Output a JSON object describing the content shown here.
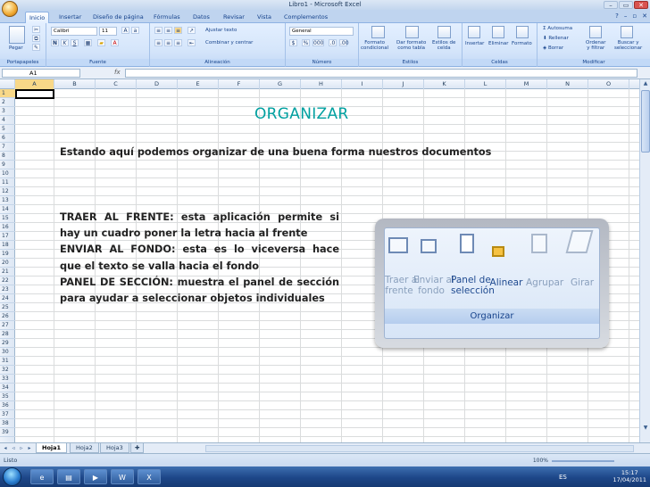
{
  "window": {
    "title": "Libro1 - Microsoft Excel",
    "min": "–",
    "max": "▭",
    "close": "✕"
  },
  "tabs": [
    "Inicio",
    "Insertar",
    "Diseño de página",
    "Fórmulas",
    "Datos",
    "Revisar",
    "Vista",
    "Complementos"
  ],
  "ribbon": {
    "paste": "Pegar",
    "font_name": "Calibri",
    "font_size": "11",
    "wrap_text": "Ajustar texto",
    "merge": "Combinar y centrar",
    "number_format": "General",
    "percent": "%",
    "thousands": "000",
    "cond_format": "Formato\ncondicional",
    "table_format": "Dar formato\ncomo tabla",
    "cell_styles": "Estilos de\ncelda",
    "insert": "Insertar",
    "delete": "Eliminar",
    "format": "Formato",
    "autosum": "Autosuma",
    "fill": "Rellenar",
    "clear": "Borrar",
    "sort_filter": "Ordenar\ny filtrar",
    "find_select": "Buscar y\nseleccionar",
    "groups": {
      "clipboard": "Portapapeles",
      "font": "Fuente",
      "alignment": "Alineación",
      "number": "Número",
      "styles": "Estilos",
      "cells": "Celdas",
      "editing": "Modificar"
    }
  },
  "formula_bar": {
    "name_box": "A1",
    "fx": "fx",
    "value": ""
  },
  "columns": [
    "A",
    "B",
    "C",
    "D",
    "E",
    "F",
    "G",
    "H",
    "I",
    "J",
    "K",
    "L",
    "M",
    "N",
    "O"
  ],
  "rows": [
    "1",
    "2",
    "3",
    "4",
    "5",
    "6",
    "7",
    "8",
    "9",
    "10",
    "11",
    "12",
    "13",
    "14",
    "15",
    "16",
    "17",
    "18",
    "19",
    "20",
    "21",
    "22",
    "23",
    "24",
    "25",
    "26",
    "27",
    "28",
    "29",
    "30",
    "31",
    "32",
    "33",
    "34",
    "35",
    "36",
    "37",
    "38",
    "39"
  ],
  "content": {
    "heading": "ORGANIZAR",
    "intro": "Estando aquí podemos organizar de una buena forma nuestros documentos",
    "para1": "TRAER AL FRENTE: esta aplicación permite si hay un cuadro poner la letra hacia al frente",
    "para2": "ENVIAR AL FONDO: esta es lo viceversa hace que el texto se valla hacia el fondo",
    "para3": "PANEL DE SECCIÓN: muestra el panel de sección para ayudar a seleccionar objetos individuales"
  },
  "zoomed_image": {
    "bring_front": "Traer al\nfrente",
    "send_back": "Enviar al\nfondo",
    "selection_pane": "Panel de\nselección",
    "align": "Alinear",
    "group": "Agrupar",
    "rotate": "Girar",
    "group_label": "Organizar"
  },
  "sheet_tabs": [
    "Hoja1",
    "Hoja2",
    "Hoja3"
  ],
  "status": {
    "text": "Listo",
    "zoom": "100%"
  },
  "taskbar": {
    "lang": "ES",
    "time": "15:17",
    "date": "17/04/2011"
  }
}
